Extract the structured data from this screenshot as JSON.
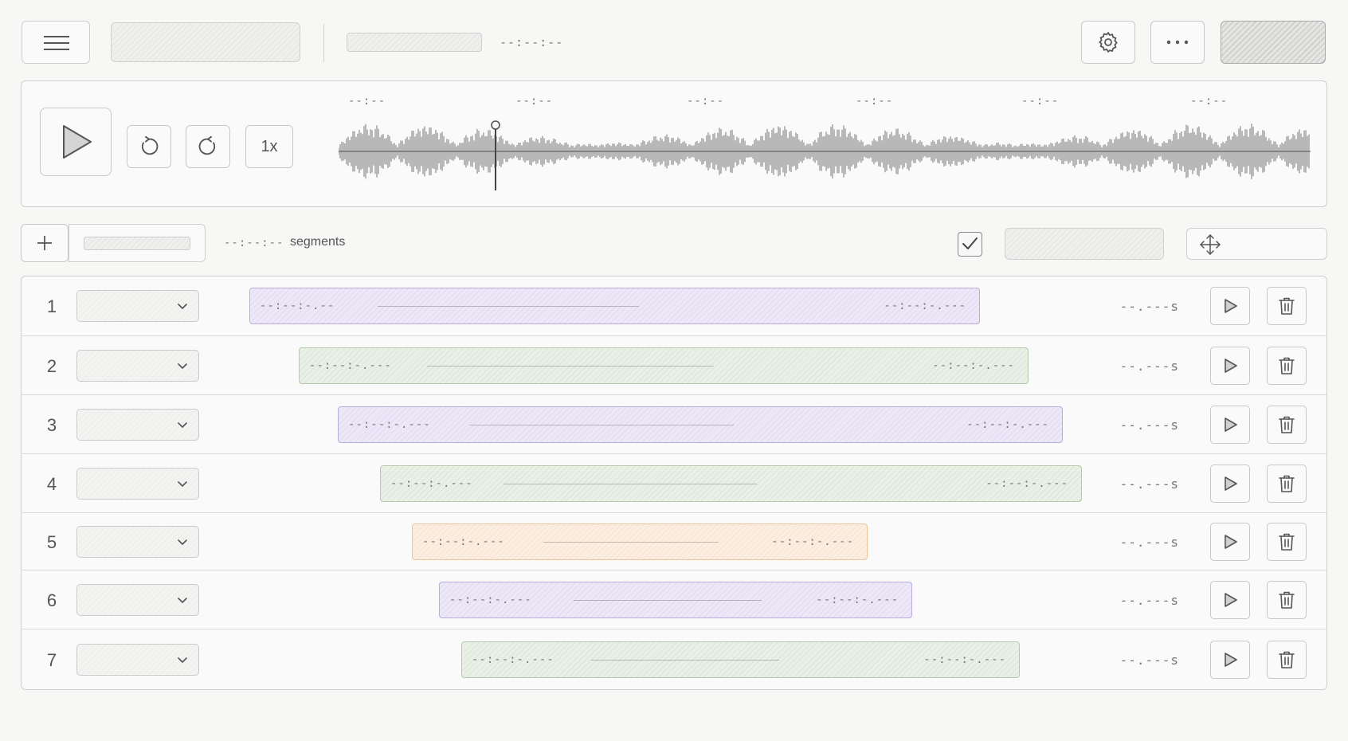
{
  "header": {
    "menu_icon": "hamburger-menu-icon",
    "time_display": "--:--:--",
    "settings_icon": "gear-icon",
    "more_icon": "more-horizontal-icon"
  },
  "player": {
    "play_icon": "play-icon",
    "rewind_icon": "rotate-back-icon",
    "forward_icon": "rotate-forward-icon",
    "speed_label": "1x",
    "time_markers": [
      "--:--",
      "--:--",
      "--:--",
      "--:--",
      "--:--",
      "--:--"
    ]
  },
  "toolbar": {
    "add_icon": "plus-icon",
    "segments_count": "--:--:--",
    "segments_label": "segments",
    "checkbox_checked": true,
    "move_icon": "move-arrows-icon"
  },
  "segments": [
    {
      "index": "1",
      "color": "purple",
      "start": "--:--:-.--",
      "end": "--:--:-.---",
      "duration": "--.---s"
    },
    {
      "index": "2",
      "color": "green",
      "start": "--:--:-.---",
      "end": "--:--:-.---",
      "duration": "--.---s"
    },
    {
      "index": "3",
      "color": "purple",
      "start": "--:--:-.---",
      "end": "--:--:-.---",
      "duration": "--.---s"
    },
    {
      "index": "4",
      "color": "green",
      "start": "--:--:-.---",
      "end": "--:--:-.---",
      "duration": "--.---s"
    },
    {
      "index": "5",
      "color": "orange",
      "start": "--:--:-.---",
      "end": "--:--:-.---",
      "duration": "--.---s"
    },
    {
      "index": "6",
      "color": "purple",
      "start": "--:--:-.---",
      "end": "--:--:-.---",
      "duration": "--.---s"
    },
    {
      "index": "7",
      "color": "green",
      "start": "--:--:-.---",
      "end": "--:--:-.---",
      "duration": "--.---s"
    }
  ],
  "colors": {
    "purple": "#b9acdc",
    "green": "#b5c9ad",
    "orange": "#eec39a"
  }
}
